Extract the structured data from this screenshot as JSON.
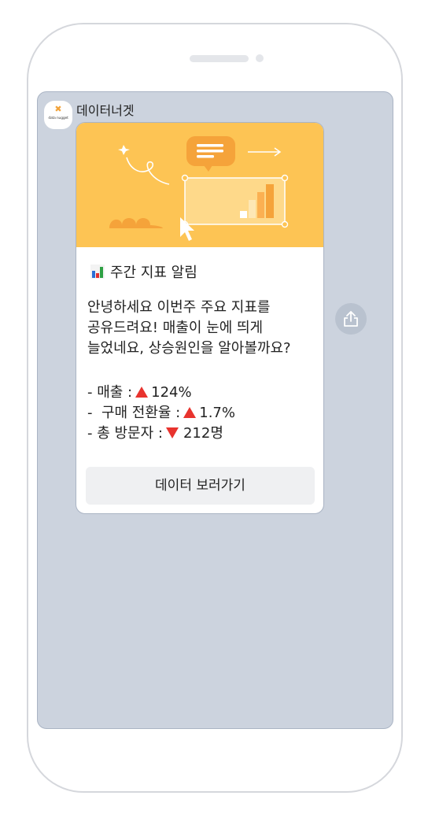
{
  "message": {
    "sender": "데이터너겟",
    "avatar": {
      "mark": "✖",
      "logo_text": "data nugget"
    },
    "card": {
      "title_icon": "bar-chart-icon",
      "title": "주간 지표 알림",
      "body": "안녕하세요 이번주 주요 지표를 공유드려요! 매출이 눈에 띄게 늘었네요, 상승원인을 알아볼까요?",
      "stats": [
        {
          "prefix": "- 매출 :",
          "direction": "up",
          "value": "124%"
        },
        {
          "prefix": "-  구매 전환율 :",
          "direction": "up",
          "value": "1.7%"
        },
        {
          "prefix": "- 총 방문자 :",
          "direction": "down",
          "value": "212명"
        }
      ],
      "button_label": "데이터 보러가기"
    },
    "share_icon": "share-icon"
  },
  "colors": {
    "banner": "#fdc454",
    "accent_orange": "#f5a33a",
    "chat_background": "#ccd3de",
    "indicator_red": "#e8332e"
  }
}
